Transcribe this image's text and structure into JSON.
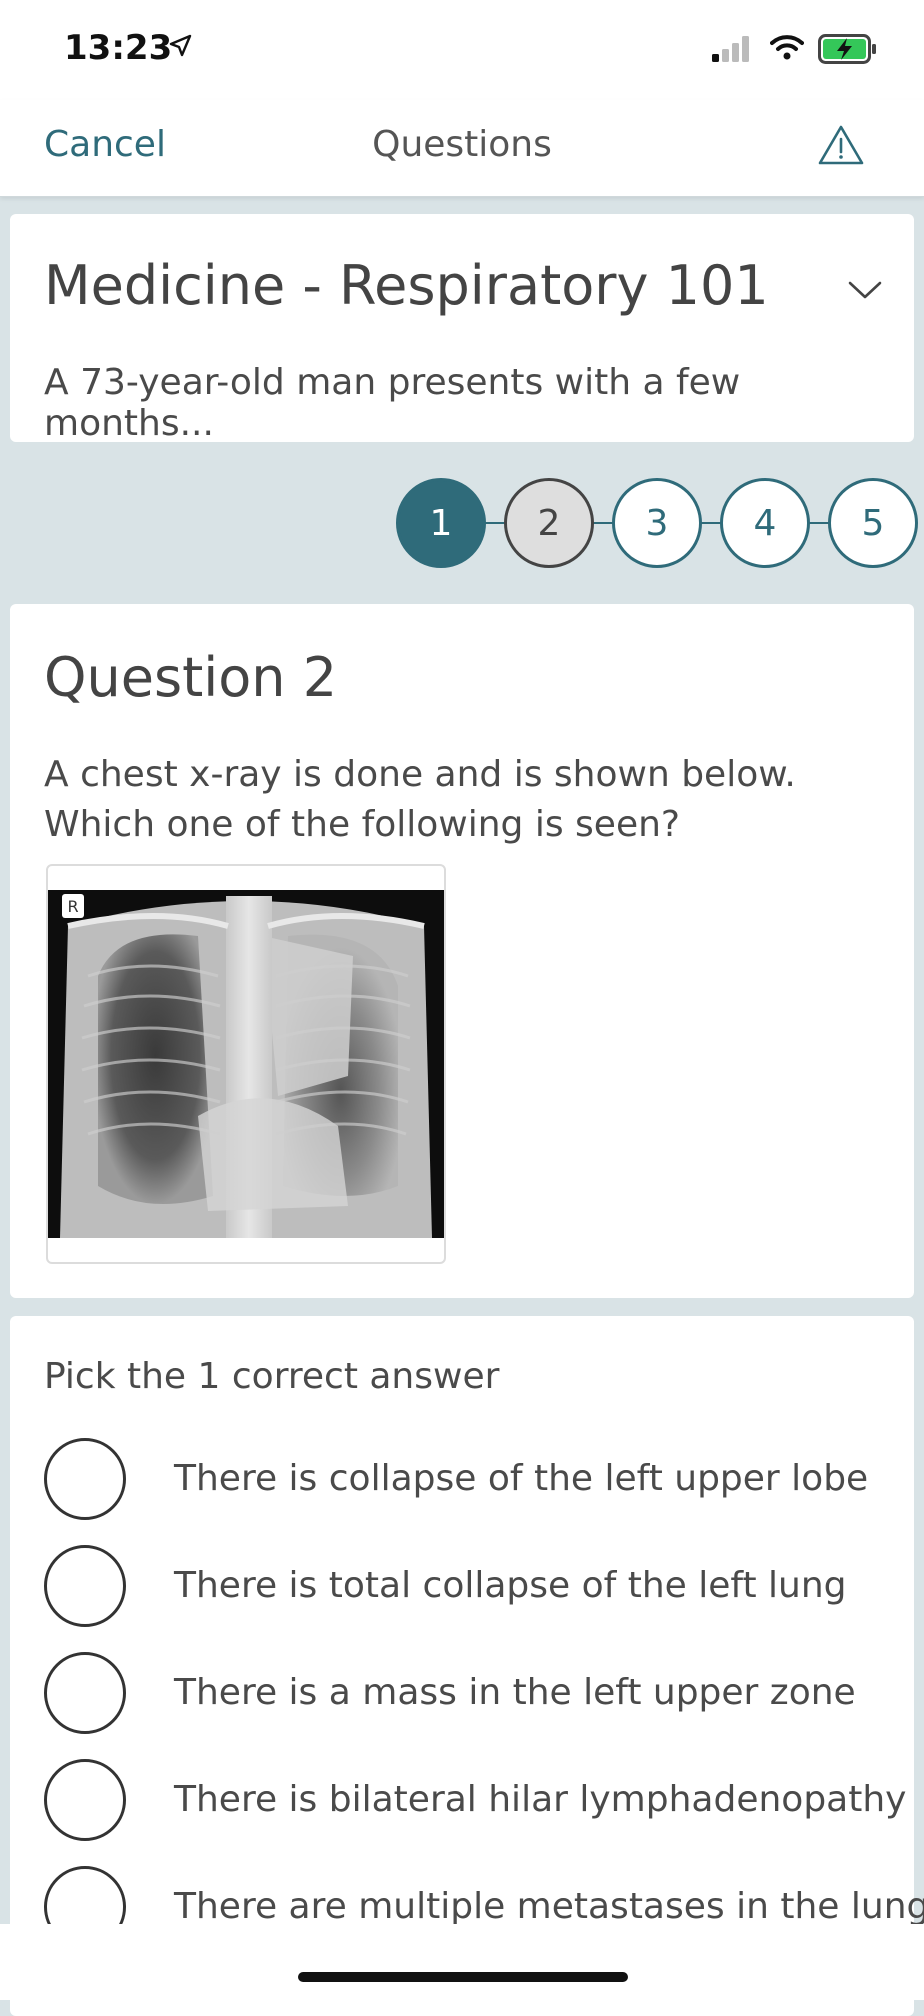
{
  "status_bar": {
    "time": "13:23"
  },
  "nav": {
    "cancel_label": "Cancel",
    "title": "Questions",
    "report_icon": "warning-triangle-icon"
  },
  "case": {
    "title": "Medicine - Respiratory 101",
    "snippet": "A 73-year-old man presents with a few months..."
  },
  "stepper": {
    "steps": [
      "1",
      "2",
      "3",
      "4",
      "5"
    ],
    "completed_index": 0,
    "current_index": 1
  },
  "question": {
    "heading": "Question 2",
    "text": "A chest x-ray is done and is shown below. Which one of the following is seen?",
    "image_marker": "R"
  },
  "answers": {
    "instruction": "Pick the 1 correct answer",
    "options": [
      "There is collapse of the left upper lobe",
      "There is total collapse of the left lung",
      "There is a mass in the left upper zone",
      "There is bilateral hilar lymphadenopathy",
      "There are multiple metastases in the lungs"
    ]
  },
  "colors": {
    "accent": "#2f6b7a",
    "background": "#d9e3e6",
    "card": "#ffffff"
  }
}
